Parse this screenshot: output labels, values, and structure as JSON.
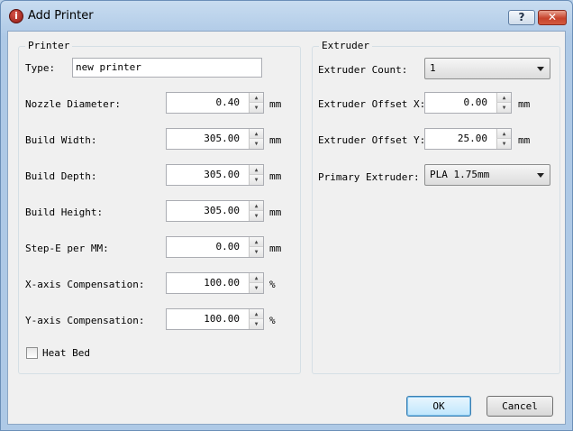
{
  "window": {
    "title": "Add Printer",
    "help_glyph": "?",
    "close_glyph": "✕",
    "app_icon_glyph": "i"
  },
  "printer": {
    "group_title": "Printer",
    "type_label": "Type:",
    "type_value": "new printer",
    "fields": [
      {
        "label": "Nozzle Diameter:",
        "value": "0.40",
        "unit": "mm"
      },
      {
        "label": "Build Width:",
        "value": "305.00",
        "unit": "mm"
      },
      {
        "label": "Build Depth:",
        "value": "305.00",
        "unit": "mm"
      },
      {
        "label": "Build Height:",
        "value": "305.00",
        "unit": "mm"
      },
      {
        "label": "Step-E per MM:",
        "value": "0.00",
        "unit": "mm"
      },
      {
        "label": "X-axis Compensation:",
        "value": "100.00",
        "unit": "%"
      },
      {
        "label": "Y-axis Compensation:",
        "value": "100.00",
        "unit": "%"
      }
    ],
    "heat_bed_label": "Heat Bed",
    "heat_bed_checked": false
  },
  "extruder": {
    "group_title": "Extruder",
    "count_label": "Extruder Count:",
    "count_value": "1",
    "offset_x_label": "Extruder Offset X:",
    "offset_x_value": "0.00",
    "offset_x_unit": "mm",
    "offset_y_label": "Extruder Offset Y:",
    "offset_y_value": "25.00",
    "offset_y_unit": "mm",
    "primary_label": "Primary Extruder:",
    "primary_value": "PLA 1.75mm"
  },
  "buttons": {
    "ok": "OK",
    "cancel": "Cancel"
  },
  "spin_up_glyph": "▲",
  "spin_down_glyph": "▼"
}
